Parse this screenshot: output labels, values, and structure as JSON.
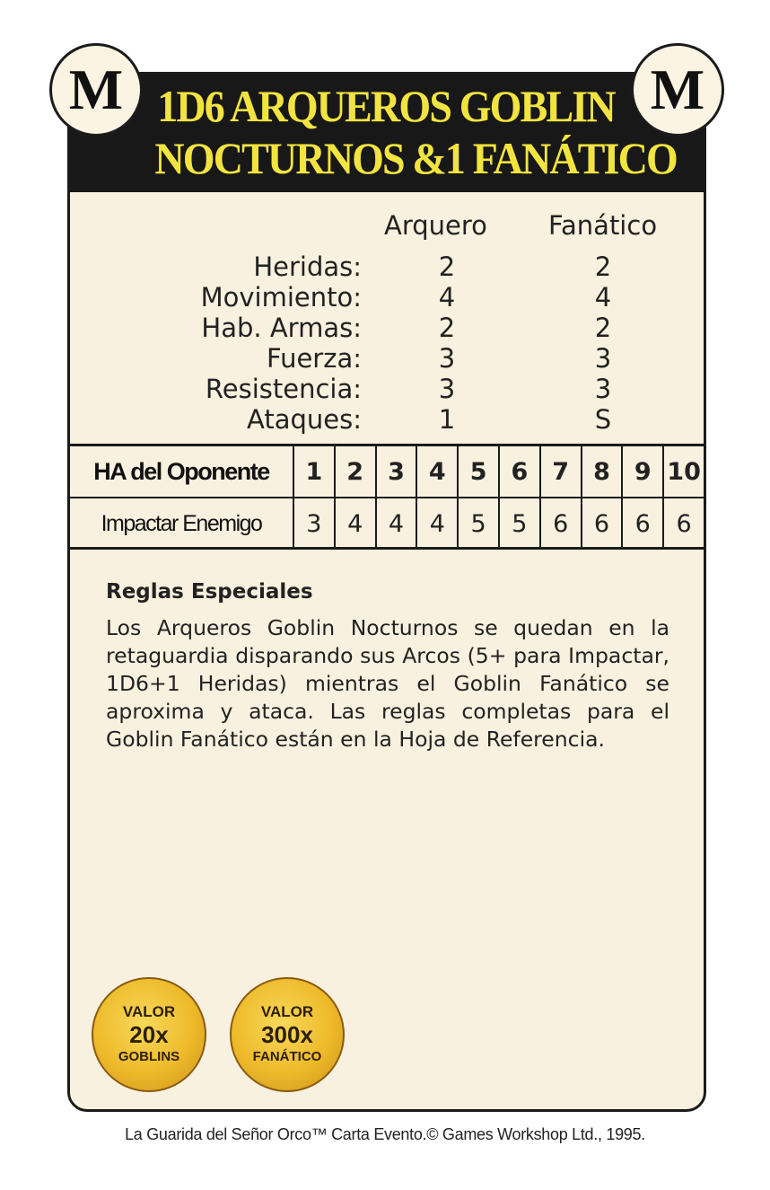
{
  "header": {
    "corner_letter_left": "M",
    "corner_letter_right": "M",
    "title_line1": "1D6 ARQUEROS GOBLIN",
    "title_line2": "NOCTURNOS &1 FANÁTICO",
    "title_color": "#f2e440"
  },
  "stats": {
    "columns": [
      "Arquero",
      "Fanático"
    ],
    "rows": [
      {
        "label": "Heridas:",
        "values": [
          "2",
          "2"
        ]
      },
      {
        "label": "Movimiento:",
        "values": [
          "4",
          "4"
        ]
      },
      {
        "label": "Hab. Armas:",
        "values": [
          "2",
          "2"
        ]
      },
      {
        "label": "Fuerza:",
        "values": [
          "3",
          "3"
        ]
      },
      {
        "label": "Resistencia:",
        "values": [
          "3",
          "3"
        ]
      },
      {
        "label": "Ataques:",
        "values": [
          "1",
          "S"
        ]
      }
    ]
  },
  "hit_table": {
    "row1_label": "HA del Oponente",
    "row1_values": [
      "1",
      "2",
      "3",
      "4",
      "5",
      "6",
      "7",
      "8",
      "9",
      "10"
    ],
    "row2_label": "Impactar Enemigo",
    "row2_values": [
      "3",
      "4",
      "4",
      "4",
      "5",
      "5",
      "6",
      "6",
      "6",
      "6"
    ]
  },
  "rules": {
    "title": "Reglas Especiales",
    "text": "Los Arqueros Goblin Nocturnos se quedan en la retaguardia disparando sus Arcos (5+ para Impactar, 1D6+1 Heridas) mientras el Goblin Fanático se aproxima y ataca. Las reglas completas para el Goblin Fanático están en la Hoja de Referencia."
  },
  "coins": [
    {
      "top": "VALOR",
      "value": "20x",
      "bottom": "GOBLINS"
    },
    {
      "top": "VALOR",
      "value": "300x",
      "bottom": "FANÁTICO"
    }
  ],
  "footer": "La Guarida del Señor Orco™ Carta Evento.© Games Workshop Ltd., 1995."
}
